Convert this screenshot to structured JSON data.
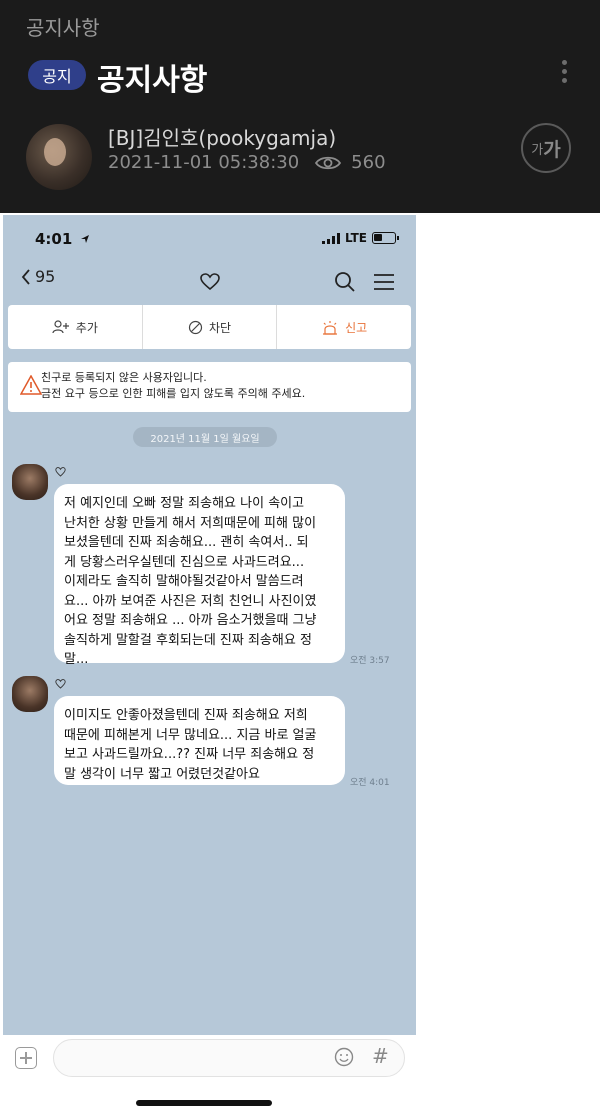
{
  "notice": {
    "section_title": "공지사항",
    "badge": "공지",
    "title": "공지사항",
    "author": "[BJ]김인호(pookygamja)",
    "datetime": "2021-11-01 05:38:30",
    "views": "560",
    "font_small": "가",
    "font_big": "가"
  },
  "phone": {
    "time": "4:01",
    "network": "LTE",
    "back_count": "95",
    "actions": {
      "add": "추가",
      "block": "차단",
      "report": "신고"
    },
    "warning_line1": "친구로 등록되지 않은 사용자입니다.",
    "warning_line2": "금전 요구 등으로 인한 피해를 입지 않도록 주의해 주세요.",
    "date": "2021년 11월 1일 월요일",
    "messages": [
      {
        "lines": [
          "저 예지인데 오빠 정말 죄송해요 나이 속이고",
          "난처한 상황 만들게 해서 저희때문에 피해 많이",
          "보셨을텐데 진짜 죄송해요... 괜히 속여서.. 되",
          "게 당황스러우실텐데 진심으로 사과드려요...",
          "이제라도 솔직히 말해야될것같아서 말씀드려",
          "요... 아까 보여준 사진은 저희 친언니 사진이였",
          "어요 정말 죄송해요 ... 아까 음소거했을때 그냥",
          "솔직하게 말할걸 후회되는데 진짜 죄송해요 정",
          "말..."
        ],
        "time": "오전 3:57"
      },
      {
        "lines": [
          "이미지도 안좋아졌을텐데 진짜 죄송해요 저희",
          "때문에 피해본게 너무 많네요... 지금 바로 얼굴",
          "보고 사과드릴까요...?? 진짜 너무 죄송해요 정",
          "말 생각이 너무 짧고 어렸던것같아요"
        ],
        "time": "오전 4:01"
      }
    ]
  },
  "colors": {
    "header_bg": "#1b1b1b",
    "badge_bg": "#2f3f8a",
    "chat_bg": "#b6c8d8",
    "report_accent": "#e8733a"
  }
}
